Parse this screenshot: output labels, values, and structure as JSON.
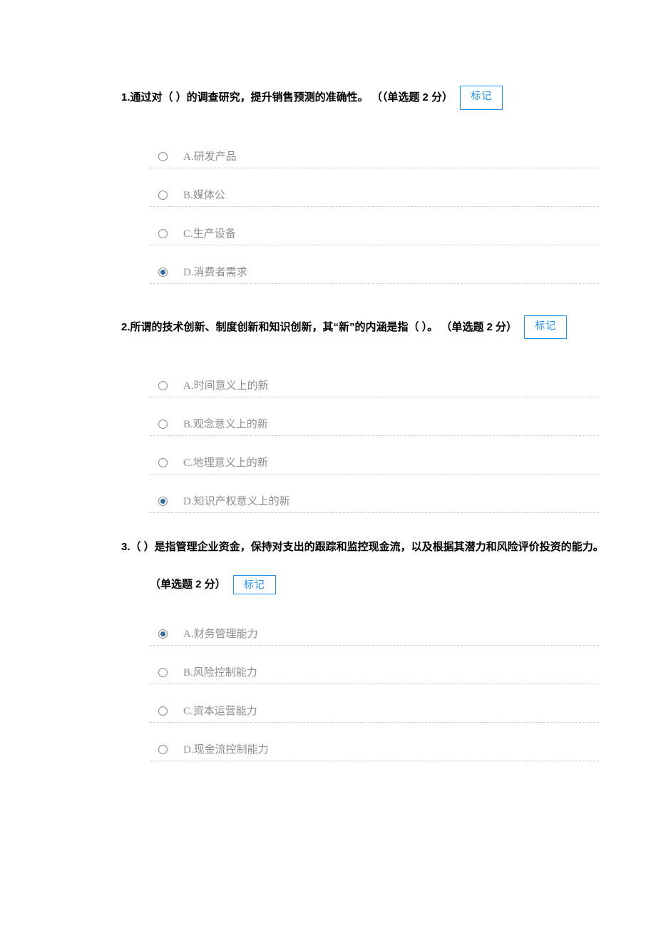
{
  "markLabel": "标记",
  "questions": [
    {
      "num": "1.",
      "text": "通过对（ ）的调查研究，提升销售预测的准确性。",
      "pts": "（（单选题 2 分）",
      "markInline": true,
      "selected": 3,
      "options": [
        {
          "label": "A.研发产品"
        },
        {
          "label": "B.媒体公"
        },
        {
          "label": "C.生产设备"
        },
        {
          "label": "D.消费者需求"
        }
      ]
    },
    {
      "num": "2.",
      "text": "所谓的技术创新、制度创新和知识创新，其“新”的内涵是指（ ）。",
      "pts": "（单选题 2 分）",
      "markInline": true,
      "selected": 3,
      "options": [
        {
          "label": "A.时间意义上的新"
        },
        {
          "label": "B.观念意义上的新"
        },
        {
          "label": "C.地理意义上的新"
        },
        {
          "label": "D.知识产权意义上的新"
        }
      ]
    },
    {
      "num": "3.",
      "text": "（ ）是指管理企业资金，保持对支出的跟踪和监控现金流，以及根据其潜力和风险评价投资的能力。",
      "pts": "（单选题 2 分）",
      "markInline": false,
      "selected": 0,
      "options": [
        {
          "label": "A.财务管理能力"
        },
        {
          "label": "B.风险控制能力"
        },
        {
          "label": "C.资本运营能力"
        },
        {
          "label": "D.现金流控制能力"
        }
      ]
    }
  ]
}
